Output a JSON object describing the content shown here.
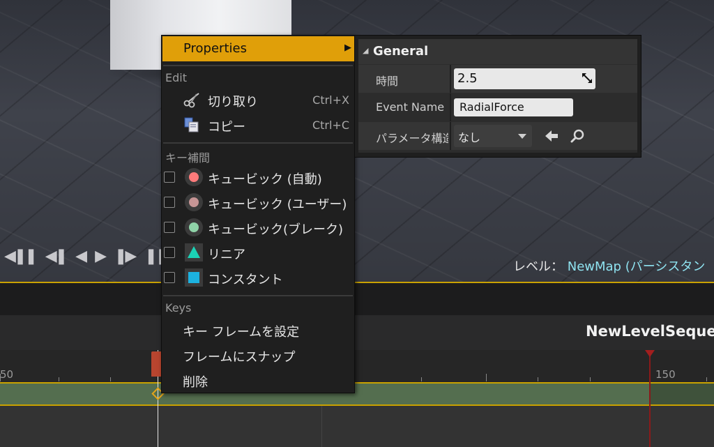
{
  "viewport": {
    "transport_buttons": [
      "◀❚❚",
      "◀❚",
      "◀",
      "▶",
      "❚▶",
      "❚❚"
    ],
    "level_label": "レベル：",
    "level_name": "NewMap (パーシスタン"
  },
  "sequencer": {
    "title": "NewLevelSequen",
    "ruler_labels": [
      "50",
      "150"
    ]
  },
  "context_menu": {
    "properties_label": "Properties",
    "properties_arrow": "▶",
    "edit_header": "Edit",
    "cut_label": "切り取り",
    "cut_shortcut": "Ctrl+X",
    "copy_label": "コピー",
    "copy_shortcut": "Ctrl+C",
    "interp_header": "キー補間",
    "interp_items": [
      {
        "label": "キュービック (自動)",
        "color": "#ff7b7b"
      },
      {
        "label": "キュービック (ユーザー)",
        "color": "#c69595"
      },
      {
        "label": "キュービック(ブレーク)",
        "color": "#8fd3a8"
      },
      {
        "label": "リニア",
        "color": "#1bd2b6"
      },
      {
        "label": "コンスタント",
        "color": "#1cb2e0"
      }
    ],
    "keys_header": "Keys",
    "set_key_time_label": "キー フレームを設定",
    "snap_to_frame_label": "フレームにスナップ",
    "delete_label": "削除"
  },
  "properties_panel": {
    "section_caret": "◢",
    "section_title": "General",
    "time_label": "時間",
    "time_value": "2.5",
    "event_name_label": "Event Name",
    "event_name_value": "RadialForce",
    "param_struct_label": "パラメータ構造",
    "param_struct_value": "なし"
  }
}
